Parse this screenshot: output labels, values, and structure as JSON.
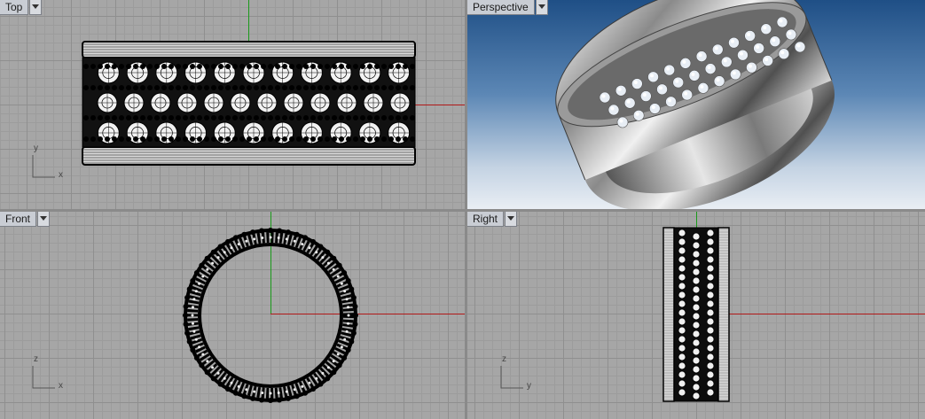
{
  "viewports": {
    "top": {
      "label": "Top",
      "axis_a": "x",
      "axis_b": "y"
    },
    "persp": {
      "label": "Perspective"
    },
    "front": {
      "label": "Front",
      "axis_a": "x",
      "axis_b": "z"
    },
    "right": {
      "label": "Right",
      "axis_a": "y",
      "axis_b": "z"
    }
  },
  "colors": {
    "x_axis": "#b01818",
    "y_axis": "#1a9a1a",
    "background_grid": "#a6a6a6",
    "perspective_sky": "#1f4f86"
  },
  "icons": {
    "viewport_menu": "dropdown-arrow-icon",
    "axis_widget": "axis-triad-icon"
  }
}
